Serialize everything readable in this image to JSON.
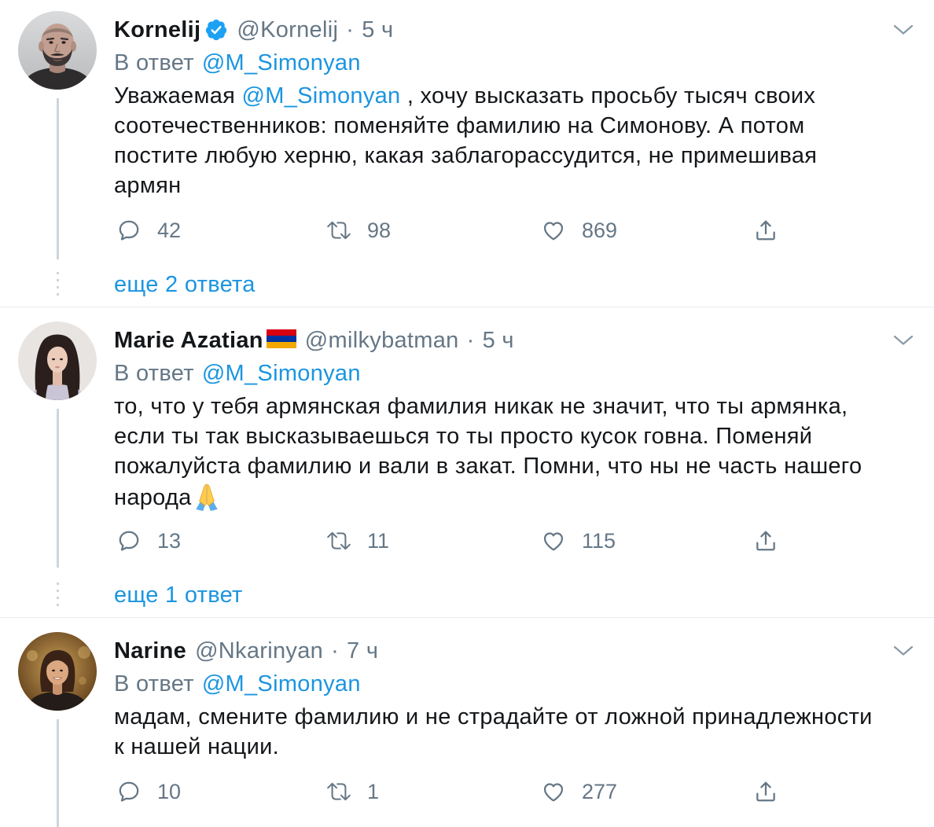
{
  "colors": {
    "text": "#14171a",
    "secondary": "#657786",
    "link": "#1b95e0",
    "divider": "#e6ecf0",
    "thread_line": "#ccd6dd",
    "verified": "#1da1f2"
  },
  "icons": {
    "reply": "reply-icon",
    "retweet": "retweet-icon",
    "like": "heart-icon",
    "share": "share-icon",
    "more": "chevron-down-icon",
    "verified": "verified-badge-icon"
  },
  "tweets": [
    {
      "name": "Kornelij",
      "verified": true,
      "handle": "@Kornelij",
      "separator": "·",
      "time": "5 ч",
      "reply_label": "В ответ",
      "reply_to": "@M_Simonyan",
      "body": {
        "lines": [
          {
            "before": "Уважаемая ",
            "mention": "@M_Simonyan",
            "after": " , хочу высказать просьбу тысяч своих"
          },
          "соотечественников: поменяйте фамилию на Симонову. А потом",
          "постите любую херню, какая заблагорассудится, не примешивая",
          "армян"
        ]
      },
      "actions": {
        "replies": "42",
        "retweets": "98",
        "likes": "869"
      },
      "more_replies": "еще 2 ответа"
    },
    {
      "name": "Marie Azatian",
      "name_emoji": "armenian-flag",
      "handle": "@milkybatman",
      "separator": "·",
      "time": "5 ч",
      "reply_label": "В ответ",
      "reply_to": "@M_Simonyan",
      "body": {
        "lines": [
          "то, что у тебя армянская фамилия никак не значит, что ты армянка,",
          "если ты так высказываешься то ты просто кусок говна. Поменяй",
          "пожалуйста фамилию и вали в закат. Помни, что ны не часть нашего",
          "народа"
        ],
        "trailing_emoji": "praying-hands"
      },
      "actions": {
        "replies": "13",
        "retweets": "11",
        "likes": "115"
      },
      "more_replies": "еще 1 ответ"
    },
    {
      "name": "Narine",
      "handle": "@Nkarinyan",
      "separator": "·",
      "time": "7 ч",
      "reply_label": "В ответ",
      "reply_to": "@M_Simonyan",
      "body": {
        "lines": [
          "мадам, смените фамилию и не страдайте от ложной принадлежности",
          "к нашей нации."
        ]
      },
      "actions": {
        "replies": "10",
        "retweets": "1",
        "likes": "277"
      }
    }
  ]
}
